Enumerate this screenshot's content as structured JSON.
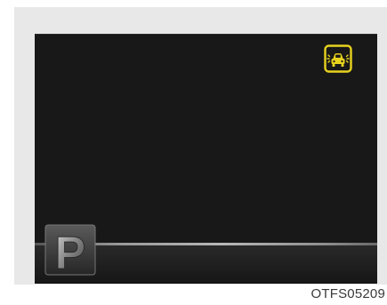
{
  "display": {
    "gear_label": "P",
    "gear_icon": "park-gear-icon",
    "warning_icon": "vehicle-sensor-warning-icon",
    "warning_color": "#e8d21e",
    "screen_color": "#181818"
  },
  "caption": "OTFS05209"
}
